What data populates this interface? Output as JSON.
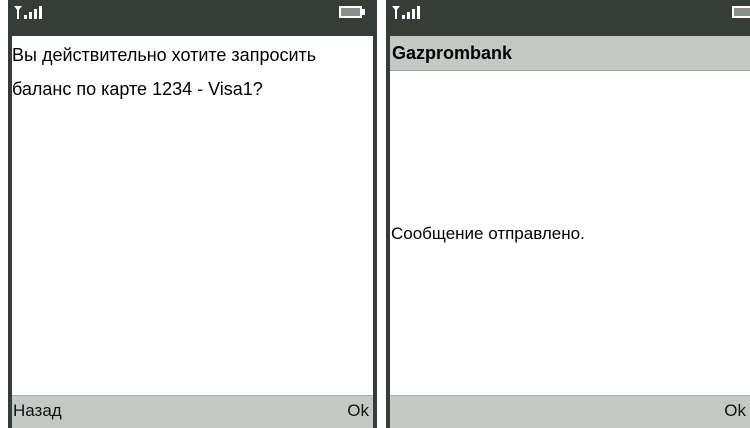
{
  "confirm_screen": {
    "message": "Вы действительно хотите запросить баланс по карте 1234 - Visa1?",
    "left_softkey": "Назад",
    "right_softkey": "Ok"
  },
  "result_screen": {
    "title": "Gazprombank",
    "message": "Сообщение отправлено.",
    "right_softkey": "Ok"
  },
  "status_icons": [
    "antenna-signal-icon",
    "battery-icon"
  ],
  "colors": {
    "phone_frame": "#363d38",
    "bar_background": "#c5c9c6",
    "screen_background": "#ffffff"
  }
}
